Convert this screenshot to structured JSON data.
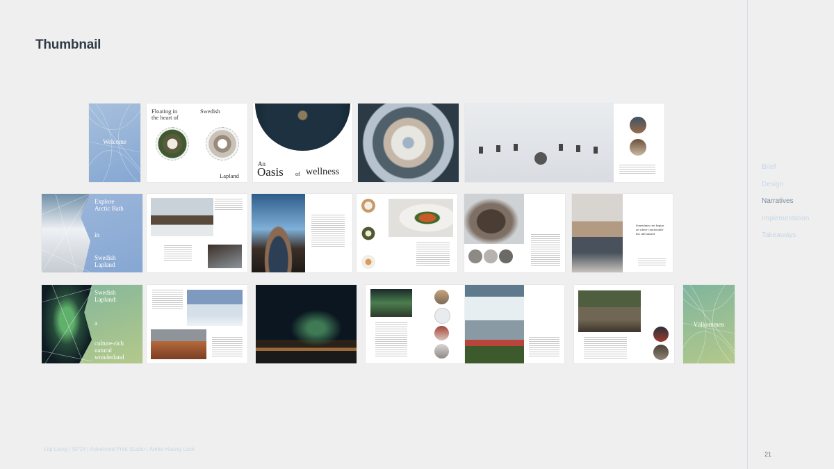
{
  "page": {
    "title": "Thumbnail",
    "footer": "Liqi Liang | SP24 | Advanced Print Studio | Annie Huang Luck",
    "page_number": "21"
  },
  "nav": {
    "items": [
      "Brief",
      "Design",
      "Narratives",
      "Implementation",
      "Takeaways"
    ],
    "active": "Narratives"
  },
  "thumbnails": {
    "welcome": "Welcome",
    "floating_1": "Floating in",
    "floating_2": "the heart of",
    "swedish": "Swedish",
    "lapland": "Lapland",
    "oasis_an": "An",
    "oasis_word": "Oasis",
    "oasis_of": "of",
    "oasis_wellness": "wellness",
    "explore_1": "Explore",
    "explore_2": "Arctic Bath",
    "explore_in": "in",
    "explore_3": "Swedish",
    "explore_4": "Lapland",
    "swedish_lapland_1": "Swedish",
    "swedish_lapland_2": "Lapland:",
    "swedish_lapland_a": "a",
    "culture_1": "culture-rich",
    "culture_2": "natural",
    "culture_3": "wonderland",
    "valkommen": "Välkommen",
    "bed_caption": "Sometimes rest begins on where comfortable but still aboard"
  }
}
